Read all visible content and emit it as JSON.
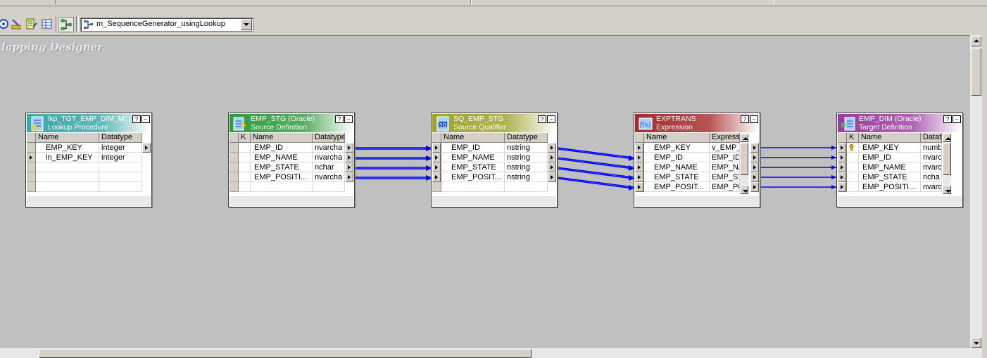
{
  "toolbar": {
    "mapping_name": "m_SequenceGenerator_usingLookup"
  },
  "canvas": {
    "title": "lapping Designer"
  },
  "colors": {
    "lookup_header": "#3aa7a7",
    "source_header": "#2f9a3c",
    "qualifier_header": "#9ea12a",
    "expression_header": "#a52a2a",
    "target_header": "#9a3c9e",
    "link": "#0000ff"
  },
  "transformations": {
    "lookup": {
      "title": "lkp_TGT_EMP_DIM_M...",
      "subtitle": "Lookup Procedure",
      "columns": [
        "Name",
        "Datatype"
      ],
      "rows": [
        {
          "name": "EMP_KEY",
          "type": "integer"
        },
        {
          "name": "in_EMP_KEY",
          "type": "integer"
        }
      ]
    },
    "source": {
      "title": "EMP_STG (Oracle)",
      "subtitle": "Source Definition",
      "key_col": "K",
      "columns": [
        "Name",
        "Datatype"
      ],
      "rows": [
        {
          "name": "EMP_ID",
          "type": "nvarcha"
        },
        {
          "name": "EMP_NAME",
          "type": "nvarcha"
        },
        {
          "name": "EMP_STATE",
          "type": "nchar"
        },
        {
          "name": "EMP_POSITI...",
          "type": "nvarcha"
        }
      ]
    },
    "qualifier": {
      "title": "SQ_EMP_STG",
      "subtitle": "Source Qualifier",
      "columns": [
        "Name",
        "Datatype"
      ],
      "rows": [
        {
          "name": "EMP_ID",
          "type": "nstring"
        },
        {
          "name": "EMP_NAME",
          "type": "nstring"
        },
        {
          "name": "EMP_STATE",
          "type": "nstring"
        },
        {
          "name": "EMP_POSIT...",
          "type": "nstring"
        }
      ]
    },
    "expression": {
      "title": "EXPTRANS",
      "subtitle": "Expression",
      "columns": [
        "Name",
        "Expressi"
      ],
      "rows": [
        {
          "name": "EMP_KEY",
          "type": "v_EMP_"
        },
        {
          "name": "EMP_ID",
          "type": "EMP_ID"
        },
        {
          "name": "EMP_NAME",
          "type": "EMP_NA"
        },
        {
          "name": "EMP_STATE",
          "type": "EMP_ST"
        },
        {
          "name": "EMP_POSIT...",
          "type": "EMP_PO"
        }
      ]
    },
    "target": {
      "title": "EMP_DIM (Oracle)",
      "subtitle": "Target Definition",
      "key_col": "K",
      "columns": [
        "Name",
        "Datat"
      ],
      "rows": [
        {
          "name": "EMP_KEY",
          "type": "numb"
        },
        {
          "name": "EMP_ID",
          "type": "nvarc"
        },
        {
          "name": "EMP_NAME",
          "type": "nvarc"
        },
        {
          "name": "EMP_STATE",
          "type": "ncha"
        },
        {
          "name": "EMP_POSITI...",
          "type": "nvarc"
        }
      ]
    }
  }
}
